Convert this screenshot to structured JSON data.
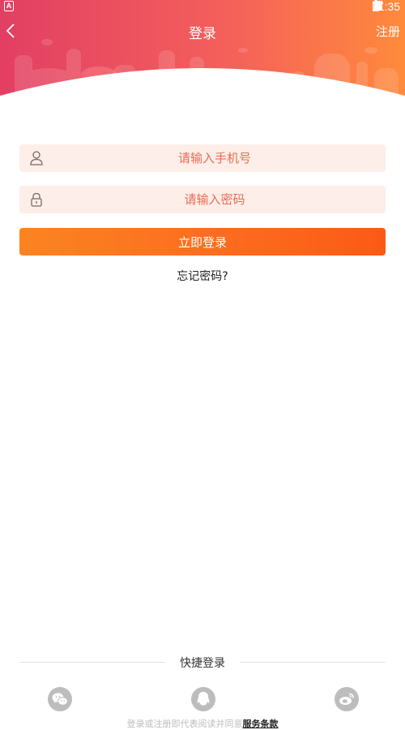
{
  "status_bar": {
    "time": "11:35",
    "left_icon": "A"
  },
  "nav": {
    "title": "登录",
    "register": "注册",
    "back_icon": "chevron-left-icon"
  },
  "form": {
    "phone_placeholder": "请输入手机号",
    "password_placeholder": "请输入密码",
    "login_button": "立即登录",
    "forgot_password": "忘记密码?"
  },
  "quick_login": {
    "title": "快捷登录",
    "providers": [
      "wechat-icon",
      "qq-icon",
      "weibo-icon"
    ]
  },
  "terms": {
    "text": "登录或注册即代表阅读并同意",
    "link": "服务条款"
  },
  "colors": {
    "accent": "#fc6a1f",
    "header_start": "#e23f63",
    "header_end": "#ff8a3c",
    "input_bg": "#fdeee9",
    "placeholder": "#ea6c55"
  }
}
